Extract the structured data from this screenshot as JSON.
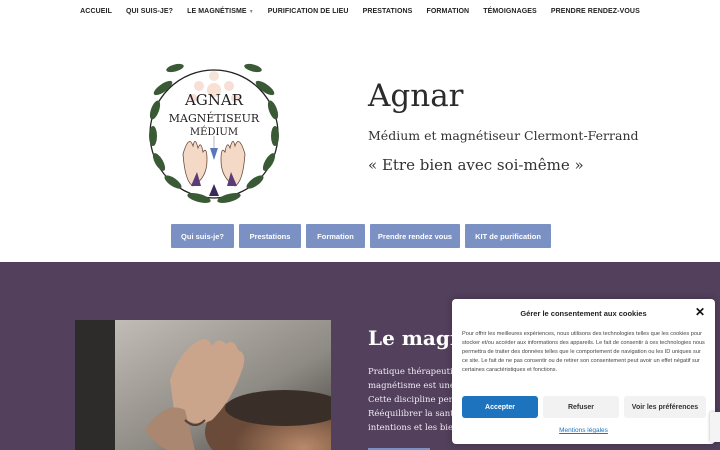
{
  "nav": {
    "items": [
      {
        "label": "ACCUEIL"
      },
      {
        "label": "QUI SUIS-JE?"
      },
      {
        "label": "LE MAGNÉTISME"
      },
      {
        "label": "PURIFICATION DE LIEU"
      },
      {
        "label": "PRESTATIONS"
      },
      {
        "label": "FORMATION"
      },
      {
        "label": "TÉMOIGNAGES"
      },
      {
        "label": "PRENDRE RENDEZ-VOUS"
      }
    ]
  },
  "logo": {
    "line1": "AGNAR",
    "line2": "MAGNÉTISEUR",
    "line3": "MÉDIUM",
    "icon": "logo-hands-pendulum"
  },
  "hero": {
    "title": "Agnar",
    "subtitle": "Médium et magnétiseur Clermont-Ferrand",
    "quote": "« Etre bien avec soi-même »"
  },
  "buttons": [
    {
      "label": "Qui suis-je?"
    },
    {
      "label": "Prestations"
    },
    {
      "label": "Formation"
    },
    {
      "label": "Prendre rendez vous"
    },
    {
      "label": "KIT de purification"
    }
  ],
  "section": {
    "title": "Le magnétisme",
    "paragraph_lines": [
      "Pratique thérapeutique",
      "magnétisme est une s",
      "Cette discipline perm",
      "Rééquilibrer la santé",
      "intentions et les bien"
    ]
  },
  "cookie": {
    "title": "Gérer le consentement aux cookies",
    "text": "Pour offrir les meilleures expériences, nous utilisons des technologies telles que les cookies pour stocker et/ou accéder aux informations des appareils. Le fait de consentir à ces technologies nous permettra de traiter des données telles que le comportement de navigation ou les ID uniques sur ce site. Le fait de ne pas consentir ou de retirer son consentement peut avoir un effet négatif sur certaines caractéristiques et fonctions.",
    "accept": "Accepter",
    "refuse": "Refuser",
    "prefs": "Voir les préférences",
    "link": "Mentions légales"
  },
  "colors": {
    "accent": "#7b91c4",
    "purple": "#53405c",
    "cookie_accept": "#1e73be"
  }
}
